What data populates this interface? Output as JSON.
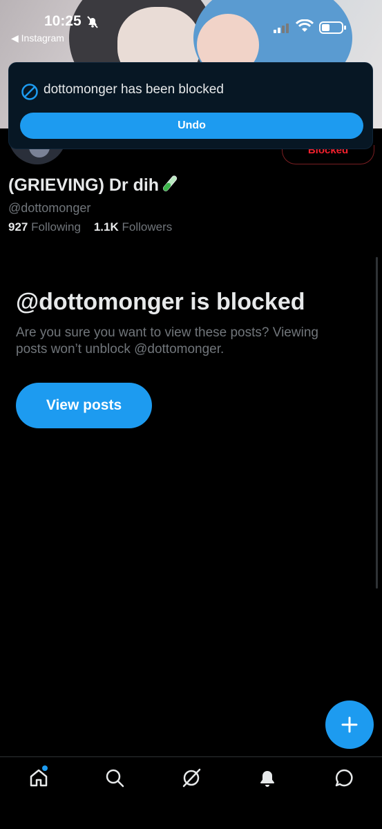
{
  "status_bar": {
    "time": "10:25",
    "back_app": "◀ Instagram",
    "icons": [
      "bell-slash-icon",
      "signal-icon",
      "wifi-icon",
      "battery-icon"
    ]
  },
  "toast": {
    "icon": "blocked-icon",
    "message": "dottomonger has been blocked",
    "undo_label": "Undo"
  },
  "profile": {
    "display_name": "(GRIEVING) Dr dih",
    "name_emoji": "test-tube-icon",
    "handle": "@dottomonger",
    "following_count": "927",
    "following_label": "Following",
    "followers_count": "1.1K",
    "followers_label": "Followers",
    "blocked_button_label": "Blocked"
  },
  "blocked_notice": {
    "title": "@dottomonger is blocked",
    "description": "Are you sure you want to view these posts? Viewing posts won’t unblock @dottomonger.",
    "view_posts_label": "View posts"
  },
  "fab": {
    "icon": "plus-icon"
  },
  "bottom_nav": {
    "items": [
      "home-icon",
      "search-icon",
      "grok-icon",
      "notifications-icon",
      "messages-icon"
    ],
    "unread_dot_on": "home-icon"
  },
  "colors": {
    "accent": "#1d9bf0",
    "blocked_red": "#f4212e",
    "background": "#000000",
    "secondary_text": "#71767b"
  }
}
